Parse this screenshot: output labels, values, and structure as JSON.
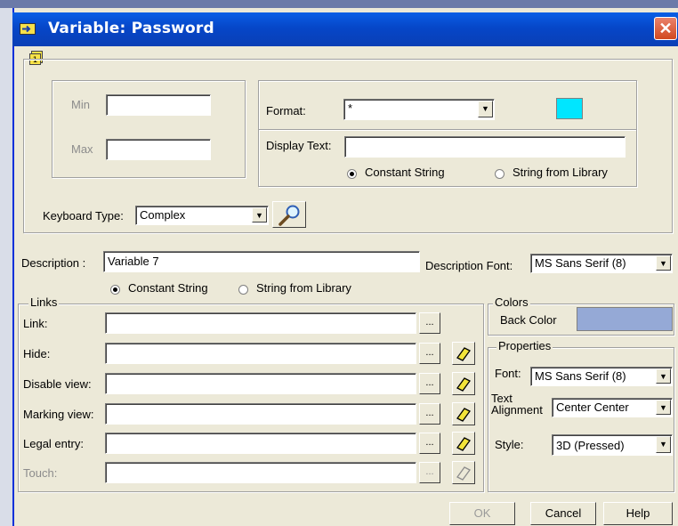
{
  "window": {
    "title": "Variable: Password",
    "close_glyph": "✕",
    "page_icon_text": "1"
  },
  "range": {
    "min_label": "Min",
    "min_value": "",
    "max_label": "Max",
    "max_value": ""
  },
  "format": {
    "label": "Format:",
    "value": "*",
    "color_swatch": "#00e6ff"
  },
  "display_text": {
    "label": "Display Text:",
    "value": "",
    "option_constant": "Constant String",
    "option_library": "String from Library",
    "selected": "constant"
  },
  "keyboard": {
    "label": "Keyboard Type:",
    "value": "Complex"
  },
  "description": {
    "label": "Description :",
    "value": "Variable 7",
    "option_constant": "Constant String",
    "option_library": "String from Library",
    "selected": "constant"
  },
  "description_font": {
    "label": "Description Font:",
    "value": "MS Sans Serif (8)"
  },
  "links": {
    "group_label": "Links",
    "rows": [
      {
        "label": "Link:",
        "value": "",
        "has_eraser": false,
        "disabled": false
      },
      {
        "label": "Hide:",
        "value": "",
        "has_eraser": true,
        "disabled": false
      },
      {
        "label": "Disable view:",
        "value": "",
        "has_eraser": true,
        "disabled": false
      },
      {
        "label": "Marking view:",
        "value": "",
        "has_eraser": true,
        "disabled": false
      },
      {
        "label": "Legal entry:",
        "value": "",
        "has_eraser": true,
        "disabled": false
      },
      {
        "label": "Touch:",
        "value": "",
        "has_eraser": true,
        "disabled": true
      }
    ],
    "browse_label": "..."
  },
  "colors": {
    "group_label": "Colors",
    "back_color_label": "Back Color",
    "back_color": "#95a9d6"
  },
  "properties": {
    "group_label": "Properties",
    "font_label": "Font:",
    "font_value": "MS Sans Serif (8)",
    "align_label_1": "Text",
    "align_label_2": "Alignment",
    "align_value": "Center Center",
    "style_label": "Style:",
    "style_value": "3D (Pressed)"
  },
  "buttons": {
    "ok": "OK",
    "cancel": "Cancel",
    "help": "Help"
  },
  "theme": {
    "title_blue": "#0646c8",
    "dialog_bg": "#ece9d8"
  }
}
